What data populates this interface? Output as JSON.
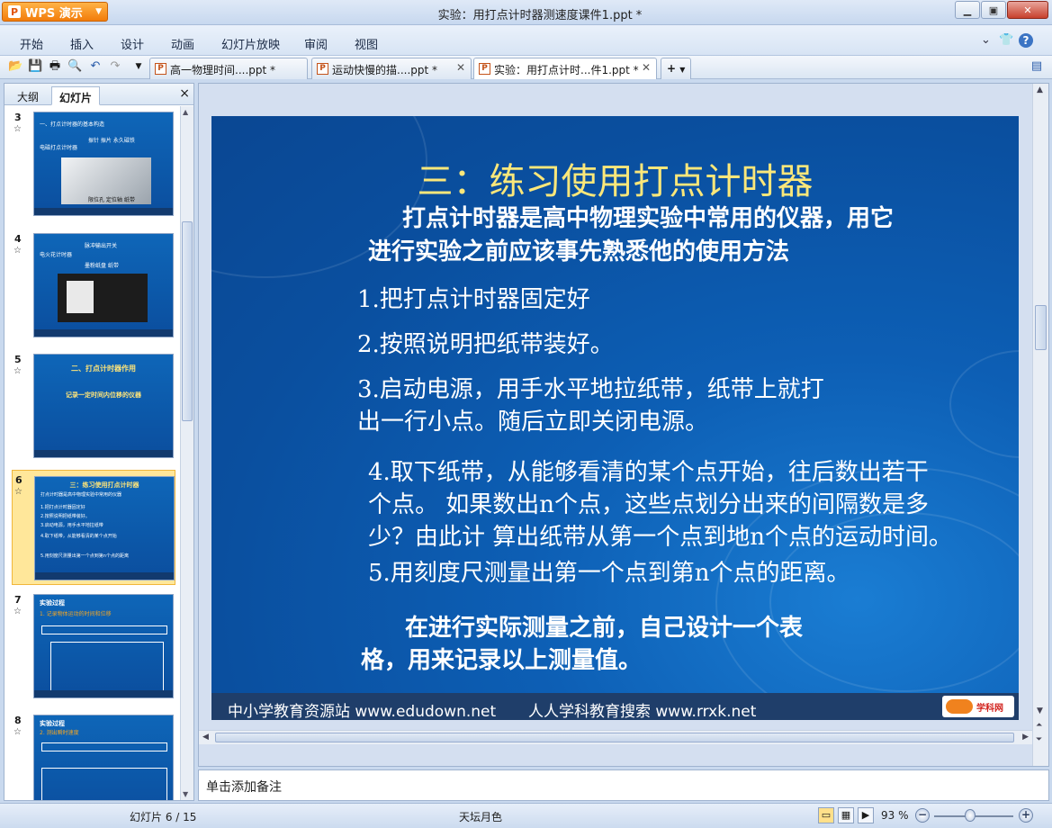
{
  "app": {
    "name": "WPS 演示",
    "logo_letter": "P",
    "window_title": "实验：用打点计时器测速度课件1.ppt *"
  },
  "window_controls": {
    "minimize": "▁",
    "restore": "▣",
    "close": "✕"
  },
  "menu": {
    "items": [
      "开始",
      "插入",
      "设计",
      "动画",
      "幻灯片放映",
      "审阅",
      "视图"
    ],
    "right": {
      "chevron": "⌄",
      "shirt": "👕",
      "help": "?"
    }
  },
  "doc_tabs": [
    {
      "label": "高一物理时间....ppt *",
      "active": false
    },
    {
      "label": "运动快慢的描....ppt *",
      "active": false
    },
    {
      "label": "实验：用打点计时...件1.ppt *",
      "active": true
    }
  ],
  "new_tab_label": "+",
  "left_panel": {
    "tabs": [
      "大纲",
      "幻灯片"
    ],
    "active_tab": "幻灯片",
    "close": "×",
    "slides": [
      {
        "number": "3",
        "title": "一、打点计时器的基本构造",
        "lines": [
          "电磁打点计时器",
          "振针  振片  永久磁铁",
          "限位孔  定位轴  纸带"
        ],
        "kind": "photo"
      },
      {
        "number": "4",
        "title": "",
        "lines": [
          "电火花计时器",
          "脉冲输出开关",
          "墨粉纸盘  纸带"
        ],
        "kind": "device"
      },
      {
        "number": "5",
        "title": "二、打点计时器作用",
        "lines": [
          "记录一定时间内位移的仪器"
        ],
        "kind": "text"
      },
      {
        "number": "6",
        "title": "三：练习使用打点计时器",
        "lines": [
          "打点计时器是高中物理实验中常用的仪器",
          "1.把打点计时器固定好",
          "2.按照说明把纸带装好。",
          "3.启动电源，用手水平地拉纸带",
          "4.取下纸带，从能够看清的某个点开始",
          "5.用刻度尺测量出第一个点到第n个点的距离"
        ],
        "kind": "text",
        "selected": true
      },
      {
        "number": "7",
        "title": "实验过程",
        "lines": [
          "1. 记录物体运动的时间和位移"
        ],
        "kind": "table"
      },
      {
        "number": "8",
        "title": "实验过程",
        "lines": [
          "2. 测出瞬时速度"
        ],
        "kind": "table"
      }
    ]
  },
  "slide": {
    "title": "三：练习使用打点计时器",
    "intro": [
      "打点计时器是高中物理实验中常用的仪器，用它",
      "进行实验之前应该事先熟悉他的使用方法"
    ],
    "steps": [
      [
        "1.把打点计时器固定好"
      ],
      [
        "2.按照说明把纸带装好。"
      ],
      [
        "3.启动电源，用手水平地拉纸带，纸带上就打",
        "出一行小点。随后立即关闭电源。"
      ],
      [
        "4.取下纸带，从能够看清的某个点开始，往后数出若干",
        "个点。 如果数出n个点，这些点划分出来的间隔数是多",
        "少？由此计 算出纸带从第一个点到地n个点的运动时间。"
      ],
      [
        "5.用刻度尺测量出第一个点到第n个点的距离。"
      ]
    ],
    "closing": [
      "在进行实际测量之前，自己设计一个表",
      "格，用来记录以上测量值。"
    ],
    "footer": {
      "left": "中小学教育资源站 www.edudown.net",
      "right": "人人学科教育搜索  www.rrxk.net",
      "logo": "学科网"
    }
  },
  "notes_placeholder": "单击添加备注",
  "status": {
    "slide_indicator": "幻灯片 6 / 15",
    "theme": "天坛月色",
    "zoom": "93 %",
    "zoom_fraction": 0.45
  }
}
